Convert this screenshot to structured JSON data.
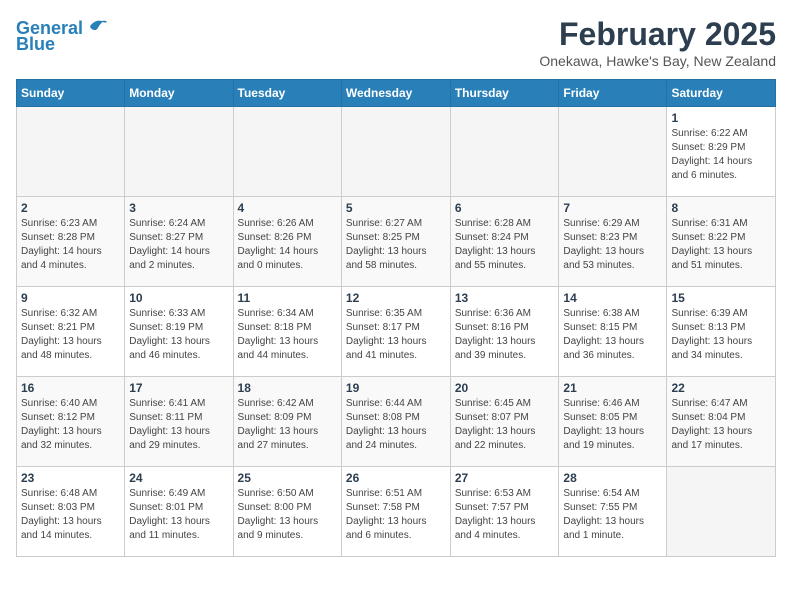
{
  "logo": {
    "line1": "General",
    "line2": "Blue"
  },
  "title": "February 2025",
  "subtitle": "Onekawa, Hawke's Bay, New Zealand",
  "days_of_week": [
    "Sunday",
    "Monday",
    "Tuesday",
    "Wednesday",
    "Thursday",
    "Friday",
    "Saturday"
  ],
  "weeks": [
    [
      {
        "day": "",
        "info": ""
      },
      {
        "day": "",
        "info": ""
      },
      {
        "day": "",
        "info": ""
      },
      {
        "day": "",
        "info": ""
      },
      {
        "day": "",
        "info": ""
      },
      {
        "day": "",
        "info": ""
      },
      {
        "day": "1",
        "info": "Sunrise: 6:22 AM\nSunset: 8:29 PM\nDaylight: 14 hours\nand 6 minutes."
      }
    ],
    [
      {
        "day": "2",
        "info": "Sunrise: 6:23 AM\nSunset: 8:28 PM\nDaylight: 14 hours\nand 4 minutes."
      },
      {
        "day": "3",
        "info": "Sunrise: 6:24 AM\nSunset: 8:27 PM\nDaylight: 14 hours\nand 2 minutes."
      },
      {
        "day": "4",
        "info": "Sunrise: 6:26 AM\nSunset: 8:26 PM\nDaylight: 14 hours\nand 0 minutes."
      },
      {
        "day": "5",
        "info": "Sunrise: 6:27 AM\nSunset: 8:25 PM\nDaylight: 13 hours\nand 58 minutes."
      },
      {
        "day": "6",
        "info": "Sunrise: 6:28 AM\nSunset: 8:24 PM\nDaylight: 13 hours\nand 55 minutes."
      },
      {
        "day": "7",
        "info": "Sunrise: 6:29 AM\nSunset: 8:23 PM\nDaylight: 13 hours\nand 53 minutes."
      },
      {
        "day": "8",
        "info": "Sunrise: 6:31 AM\nSunset: 8:22 PM\nDaylight: 13 hours\nand 51 minutes."
      }
    ],
    [
      {
        "day": "9",
        "info": "Sunrise: 6:32 AM\nSunset: 8:21 PM\nDaylight: 13 hours\nand 48 minutes."
      },
      {
        "day": "10",
        "info": "Sunrise: 6:33 AM\nSunset: 8:19 PM\nDaylight: 13 hours\nand 46 minutes."
      },
      {
        "day": "11",
        "info": "Sunrise: 6:34 AM\nSunset: 8:18 PM\nDaylight: 13 hours\nand 44 minutes."
      },
      {
        "day": "12",
        "info": "Sunrise: 6:35 AM\nSunset: 8:17 PM\nDaylight: 13 hours\nand 41 minutes."
      },
      {
        "day": "13",
        "info": "Sunrise: 6:36 AM\nSunset: 8:16 PM\nDaylight: 13 hours\nand 39 minutes."
      },
      {
        "day": "14",
        "info": "Sunrise: 6:38 AM\nSunset: 8:15 PM\nDaylight: 13 hours\nand 36 minutes."
      },
      {
        "day": "15",
        "info": "Sunrise: 6:39 AM\nSunset: 8:13 PM\nDaylight: 13 hours\nand 34 minutes."
      }
    ],
    [
      {
        "day": "16",
        "info": "Sunrise: 6:40 AM\nSunset: 8:12 PM\nDaylight: 13 hours\nand 32 minutes."
      },
      {
        "day": "17",
        "info": "Sunrise: 6:41 AM\nSunset: 8:11 PM\nDaylight: 13 hours\nand 29 minutes."
      },
      {
        "day": "18",
        "info": "Sunrise: 6:42 AM\nSunset: 8:09 PM\nDaylight: 13 hours\nand 27 minutes."
      },
      {
        "day": "19",
        "info": "Sunrise: 6:44 AM\nSunset: 8:08 PM\nDaylight: 13 hours\nand 24 minutes."
      },
      {
        "day": "20",
        "info": "Sunrise: 6:45 AM\nSunset: 8:07 PM\nDaylight: 13 hours\nand 22 minutes."
      },
      {
        "day": "21",
        "info": "Sunrise: 6:46 AM\nSunset: 8:05 PM\nDaylight: 13 hours\nand 19 minutes."
      },
      {
        "day": "22",
        "info": "Sunrise: 6:47 AM\nSunset: 8:04 PM\nDaylight: 13 hours\nand 17 minutes."
      }
    ],
    [
      {
        "day": "23",
        "info": "Sunrise: 6:48 AM\nSunset: 8:03 PM\nDaylight: 13 hours\nand 14 minutes."
      },
      {
        "day": "24",
        "info": "Sunrise: 6:49 AM\nSunset: 8:01 PM\nDaylight: 13 hours\nand 11 minutes."
      },
      {
        "day": "25",
        "info": "Sunrise: 6:50 AM\nSunset: 8:00 PM\nDaylight: 13 hours\nand 9 minutes."
      },
      {
        "day": "26",
        "info": "Sunrise: 6:51 AM\nSunset: 7:58 PM\nDaylight: 13 hours\nand 6 minutes."
      },
      {
        "day": "27",
        "info": "Sunrise: 6:53 AM\nSunset: 7:57 PM\nDaylight: 13 hours\nand 4 minutes."
      },
      {
        "day": "28",
        "info": "Sunrise: 6:54 AM\nSunset: 7:55 PM\nDaylight: 13 hours\nand 1 minute."
      },
      {
        "day": "",
        "info": ""
      }
    ]
  ]
}
